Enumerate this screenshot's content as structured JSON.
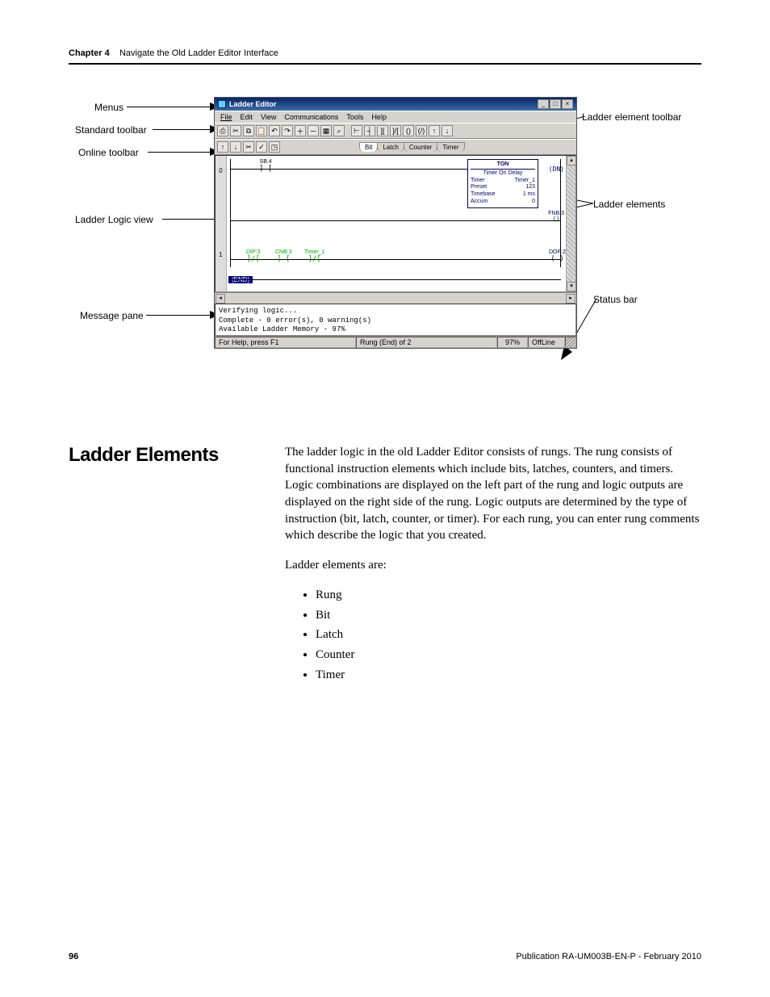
{
  "header": {
    "chapter": "Chapter 4",
    "title": "Navigate the Old Ladder Editor Interface"
  },
  "callouts": {
    "menus": "Menus",
    "standard_toolbar": "Standard toolbar",
    "online_toolbar": "Online toolbar",
    "ladder_logic_view": "Ladder Logic view",
    "message_pane": "Message pane",
    "ladder_element_toolbar": "Ladder element toolbar",
    "ladder_elements": "Ladder elements",
    "status_bar": "Status bar"
  },
  "window": {
    "title": "Ladder Editor",
    "menu": [
      "File",
      "Edit",
      "View",
      "Communications",
      "Tools",
      "Help"
    ],
    "element_tabs": [
      "Bit",
      "Latch",
      "Counter",
      "Timer"
    ],
    "rung0": {
      "contact_label": "SB:4",
      "ton": {
        "name": "TON",
        "desc": "Timer On Delay",
        "rows": [
          [
            "Timer",
            "Timer_1"
          ],
          [
            "Preset",
            "123"
          ],
          [
            "Timebase",
            "1 ms"
          ],
          [
            "Accum",
            "0"
          ]
        ],
        "dn": "(DN)"
      },
      "fnb_label": "FNB:3"
    },
    "rung1": {
      "c1": "DIP:3",
      "c2": "CNB:3",
      "c3": "Timer_1",
      "out": "DOP:2"
    },
    "end_label": "(END)",
    "messages": {
      "l1": "Verifying logic...",
      "l2": "Complete - 0 error(s), 0 warning(s)",
      "l3": "Available Ladder Memory - 97%"
    },
    "status": {
      "help": "For Help, press F1",
      "rung": "Rung (End) of 2",
      "mem": "97%",
      "mode": "OffLine"
    }
  },
  "section": {
    "heading": "Ladder Elements",
    "para1": "The ladder logic in the old Ladder Editor consists of rungs. The rung consists of functional instruction elements which include bits, latches, counters, and timers. Logic combinations are displayed on the left part of the rung and logic outputs are displayed on the right side of the rung. Logic outputs are determined by the type of instruction (bit, latch, counter, or timer). For each rung, you can enter rung comments which describe the logic that you created.",
    "para2": "Ladder elements are:",
    "bullets": [
      "Rung",
      "Bit",
      "Latch",
      "Counter",
      "Timer"
    ]
  },
  "footer": {
    "page": "96",
    "pub": "Publication RA-UM003B-EN-P - February 2010"
  },
  "chart_data": {
    "type": "table",
    "title": "TON — Timer On Delay",
    "categories": [
      "Timer",
      "Preset",
      "Timebase",
      "Accum"
    ],
    "values": [
      "Timer_1",
      "123",
      "1 ms",
      "0"
    ]
  }
}
